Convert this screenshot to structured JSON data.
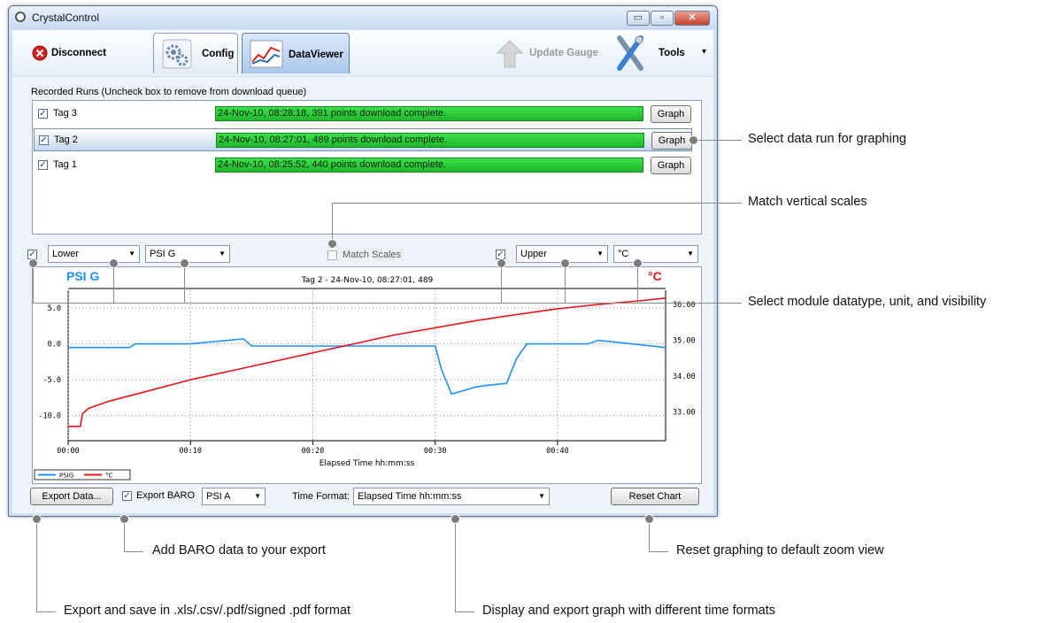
{
  "window": {
    "title": "CrystalControl",
    "min_glyph": "▭",
    "max_glyph": "▫",
    "close_glyph": "✕"
  },
  "toolbar": {
    "disconnect": "Disconnect",
    "config": "Config",
    "dataviewer": "DataViewer",
    "update_gauge": "Update Gauge",
    "tools": "Tools",
    "tools_arrow": "▾"
  },
  "runs": {
    "heading": "Recorded Runs (Uncheck box to remove from download queue)",
    "items": [
      {
        "tag": "Tag 3",
        "status": "24-Nov-10, 08:28:18, 391 points download complete.",
        "button": "Graph",
        "checked": true,
        "selected": false
      },
      {
        "tag": "Tag 2",
        "status": "24-Nov-10, 08:27:01, 489 points download complete.",
        "button": "Graph",
        "checked": true,
        "selected": true
      },
      {
        "tag": "Tag 1",
        "status": "24-Nov-10, 08:25:52, 440 points download complete.",
        "button": "Graph",
        "checked": true,
        "selected": false
      }
    ]
  },
  "controls": {
    "lower_module": "Lower",
    "lower_unit": "PSI G",
    "match_scales": "Match Scales",
    "upper_module": "Upper",
    "upper_unit": "°C",
    "check_glyph": "✓"
  },
  "chart_data": {
    "type": "line",
    "title": "Tag 2 - 24-Nov-10, 08:27:01, 489",
    "xlabel": "Elapsed Time hh:mm:ss",
    "x_ticks": [
      "00:00",
      "00:10",
      "00:20",
      "00:30",
      "00:40"
    ],
    "left_axis_label": "PSI G",
    "right_axis_label": "°C",
    "left_ticks": [
      "5.0",
      "0.0",
      "-5.0",
      "-10.0"
    ],
    "right_ticks": [
      "36.00",
      "35.00",
      "34.00",
      "33.00"
    ],
    "ylim_left": [
      -13.5,
      6
    ],
    "ylim_right": [
      32.2,
      36.1
    ],
    "xlim_seconds": [
      0,
      2930
    ],
    "grid": true,
    "legend_position": "bottom-left",
    "series": [
      {
        "name": "PSIG",
        "color": "#1e90ff",
        "axis": "left",
        "x": [
          0,
          300,
          330,
          360,
          600,
          860,
          900,
          1000,
          1760,
          1800,
          1830,
          1880,
          1940,
          2000,
          2050,
          2150,
          2200,
          2250,
          2400,
          2550,
          2600,
          2930
        ],
        "y": [
          -0.5,
          -0.5,
          0.0,
          0.0,
          0.0,
          0.7,
          -0.3,
          -0.3,
          -0.3,
          -0.3,
          -3.5,
          -7.0,
          -6.5,
          -6.0,
          -5.8,
          -5.5,
          -2.0,
          0.0,
          0.0,
          0.0,
          0.5,
          -0.5
        ]
      },
      {
        "name": "°C",
        "color": "#e8141b",
        "axis": "right",
        "x": [
          0,
          60,
          70,
          100,
          200,
          400,
          600,
          800,
          1000,
          1200,
          1400,
          1600,
          1800,
          2000,
          2200,
          2400,
          2600,
          2800,
          2930
        ],
        "y": [
          32.6,
          32.6,
          32.95,
          33.1,
          33.3,
          33.6,
          33.9,
          34.15,
          34.4,
          34.65,
          34.9,
          35.15,
          35.35,
          35.55,
          35.72,
          35.88,
          36.0,
          36.1,
          36.18
        ]
      }
    ]
  },
  "bottom": {
    "export_data": "Export Data...",
    "export_baro": "Export BARO",
    "baro_unit": "PSI A",
    "time_format_label": "Time Format:",
    "time_format_value": "Elapsed Time hh:mm:ss",
    "reset_chart": "Reset Chart"
  },
  "annotations": {
    "select_run": "Select data run for graphing",
    "match_scales": "Match vertical scales",
    "select_module": "Select module datatype, unit, and visibility",
    "add_baro": "Add BARO data to your export",
    "reset": "Reset graphing to default zoom view",
    "export": "Export and save in .xls/.csv/.pdf/signed .pdf format",
    "time_formats": "Display and export graph with different time formats"
  }
}
